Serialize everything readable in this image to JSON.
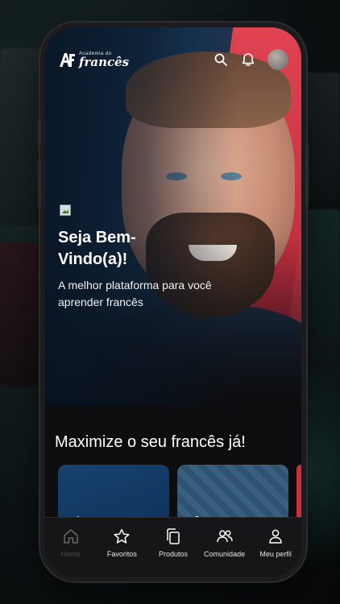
{
  "app": {
    "logo_small": "Academia do",
    "logo_big": "francês"
  },
  "header": {
    "icons": [
      "search-icon",
      "bell-icon",
      "avatar"
    ]
  },
  "hero": {
    "title": "Seja Bem-Vindo(a)!",
    "subtitle": "A melhor plataforma para você aprender francês"
  },
  "section": {
    "title": "Maximize o seu francês já!"
  },
  "nav": {
    "items": [
      {
        "label": "Home",
        "icon": "home-icon",
        "active": true
      },
      {
        "label": "Favoritos",
        "icon": "star-icon"
      },
      {
        "label": "Produtos",
        "icon": "copy-icon"
      },
      {
        "label": "Comunidade",
        "icon": "users-icon"
      },
      {
        "label": "Meu perfil",
        "icon": "user-icon"
      }
    ]
  },
  "colors": {
    "accent_red": "#e24452",
    "hero_blue": "#1a3c5c",
    "nav_bg": "#161618"
  }
}
